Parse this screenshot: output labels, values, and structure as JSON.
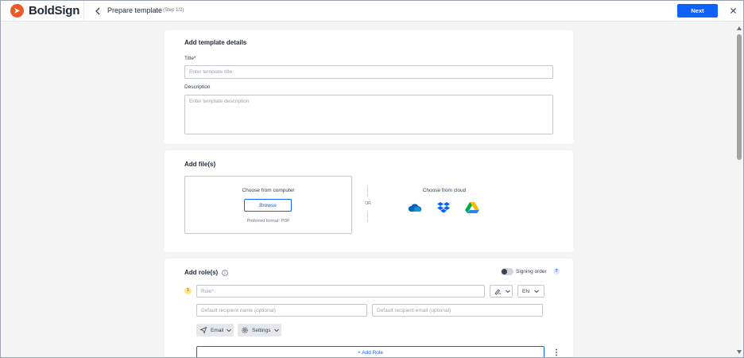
{
  "app": {
    "brand": "BoldSign",
    "brand_color": "#f05a22",
    "accent": "#0f62fe"
  },
  "header": {
    "title": "Prepare template",
    "step": "(Step 1/2)",
    "next_label": "Next",
    "back_icon": "chevron-left-icon",
    "close_icon": "close-icon"
  },
  "template_details": {
    "heading": "Add template details",
    "title_label": "Title*",
    "title_placeholder": "Enter template title",
    "title_value": "",
    "description_label": "Description",
    "description_placeholder": "Enter template description",
    "description_value": ""
  },
  "files": {
    "heading": "Add file(s)",
    "computer_title": "Choose from computer",
    "browse_label": "Browse",
    "format_hint": "Preferred format: PDF",
    "or_label": "OR",
    "cloud_title": "Choose from cloud",
    "cloud_icons": [
      "onedrive-icon",
      "dropbox-icon",
      "google-drive-icon"
    ]
  },
  "roles": {
    "heading": "Add role(s)",
    "signing_order_label": "Signing order",
    "signing_order_on": false,
    "help_glyph": "?",
    "items": [
      {
        "index": "1",
        "role_placeholder": "Role*",
        "role_value": "",
        "language": "EN",
        "name_placeholder": "Default recipient name (optional)",
        "email_placeholder": "Default recipient email (optional)",
        "delivery_label": "Email",
        "settings_label": "Settings"
      }
    ],
    "add_role_label": "+ Add Role"
  }
}
